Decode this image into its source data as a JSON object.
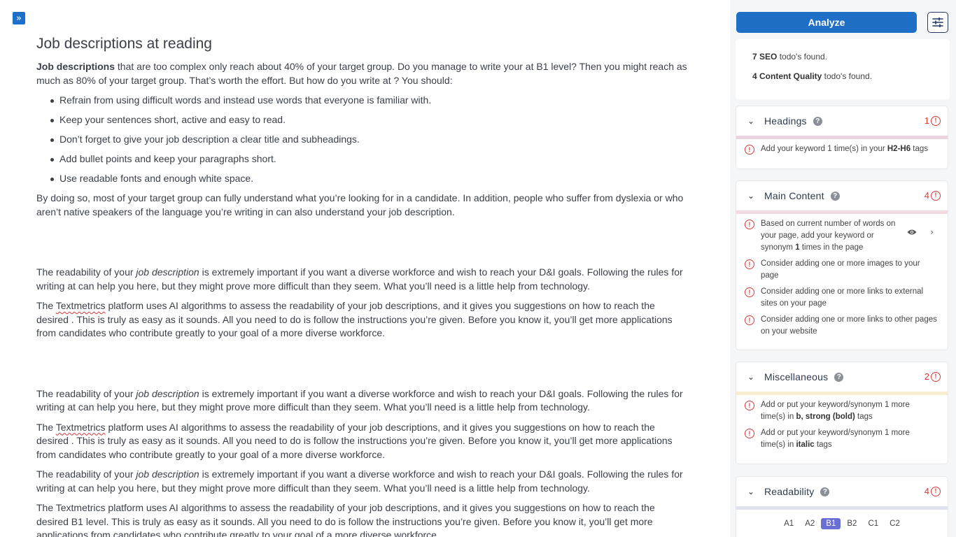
{
  "editor": {
    "title": "Job descriptions at reading",
    "intro_bold": "Job descriptions",
    "intro_rest": " that are too complex only reach about 40% of your target group. Do you manage to write your at B1 level? Then you might reach as much as 80% of your target group. That’s worth the effort. But how do you write at ? You should:",
    "bullets": [
      "Refrain from using difficult words and instead use words that everyone is familiar with.",
      "Keep your sentences short, active and easy to read.",
      "Don’t forget to give your job description a clear title and subheadings.",
      "Add bullet points and keep your paragraphs short.",
      "Use readable fonts and enough white space."
    ],
    "para_dyslexia": "By doing so, most of your target group can fully understand what you’re looking for in a candidate. In addition, people who suffer from dyslexia or who aren’t native speakers of the language you’re writing in can also understand your job description.",
    "read_a": "The readability of your ",
    "read_em": "job description",
    "read_b": " is extremely important if you want a diverse workforce and wish to reach your D&I goals. Following the rules for writing at can help you here, but they might prove more difficult than they seem. What you’ll need is a little help from technology.",
    "tm_a": "The ",
    "tm_word": "Textmetrics",
    "tm_b": " platform uses AI algorithms to assess the readability of your job descriptions, and it gives you suggestions on how to reach the desired . This is truly as easy as it sounds. All you need to do is follow the instructions you’re given. Before you know it, you’ll get more applications from candidates who contribute greatly to your goal of a more diverse workforce.",
    "tm_full_b1": "The Textmetrics platform uses AI algorithms to assess the readability of your job descriptions, and it gives you suggestions on how to reach the desired B1 level. This is truly as easy as it sounds. All you need to do is follow the instructions you’re given. Before you know it, you’ll get more applications from candidates who contribute greatly to your goal of a more diverse workforce."
  },
  "panel": {
    "analyze_label": "Analyze",
    "summary": {
      "seo_bold": "7 SEO",
      "seo_rest": " todo's found.",
      "cq_bold": "4 Content Quality",
      "cq_rest": " todo's found."
    },
    "headings": {
      "title": "Headings",
      "count": "1",
      "color": "#e8d3df",
      "issue_a": "Add your keyword 1 time(s) in your ",
      "issue_b": "H2-H6",
      "issue_c": " tags"
    },
    "main_content": {
      "title": "Main Content",
      "count": "4",
      "color": "#f3d9e0",
      "issue1_a": "Based on current number of words on your page, add your keyword or synonym ",
      "issue1_b": "1",
      "issue1_c": " times in the page",
      "issue2": "Consider adding one or more images to your page",
      "issue3": "Consider adding one or more links to external sites on your page",
      "issue4": "Consider adding one or more links to other pages on your website"
    },
    "misc": {
      "title": "Miscellaneous",
      "count": "2",
      "color": "#f7edcf",
      "issue1_a": "Add or put your keyword/synonym 1 more time(s) in ",
      "issue1_b": "b, strong (bold)",
      "issue1_c": " tags",
      "issue2_a": "Add or put your keyword/synonym 1 more time(s) in ",
      "issue2_b": "italic",
      "issue2_c": " tags"
    },
    "readability": {
      "title": "Readability",
      "count": "4",
      "color": "#dfe3ee",
      "levels": [
        "A1",
        "A2",
        "B1",
        "B2",
        "C1",
        "C2"
      ],
      "active_level": "B1"
    },
    "icons": {
      "help": "?",
      "alert": "!"
    }
  }
}
